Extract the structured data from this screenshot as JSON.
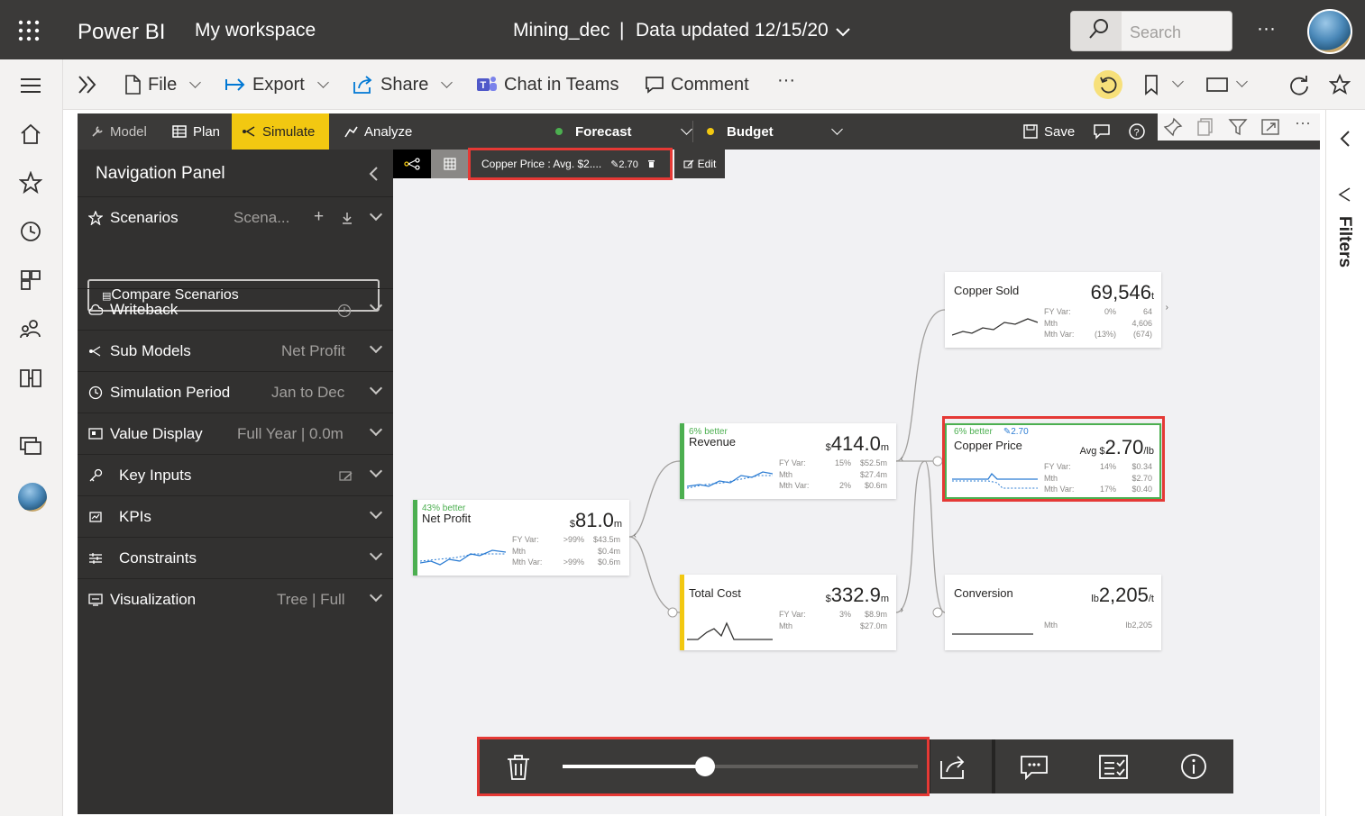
{
  "topbar": {
    "app_name": "Power BI",
    "workspace": "My workspace",
    "report_name": "Mining_dec",
    "separator": "|",
    "data_updated": "Data updated 12/15/20",
    "search_placeholder": "Search",
    "more": "···"
  },
  "toolbar": {
    "file": "File",
    "export": "Export",
    "share": "Share",
    "chat_in_teams": "Chat in Teams",
    "comment": "Comment",
    "more": "···"
  },
  "visual_header": {
    "tabs": [
      {
        "label": "Model",
        "active": false
      },
      {
        "label": "Plan",
        "active": false
      },
      {
        "label": "Simulate",
        "active": true
      },
      {
        "label": "Analyze",
        "active": false
      }
    ],
    "forecast": "Forecast",
    "budget": "Budget",
    "save": "Save",
    "colors": {
      "forecast_dot": "#4caf50",
      "budget_dot": "#f2c811",
      "accent": "#f2c811"
    }
  },
  "nav_panel": {
    "title": "Navigation Panel",
    "scenarios": {
      "label": "Scenarios",
      "value": "Scena..."
    },
    "compare_button": "Compare Scenarios",
    "rows": [
      {
        "label": "Writeback",
        "value": ""
      },
      {
        "label": "Sub Models",
        "value": "Net Profit"
      },
      {
        "label": "Simulation Period",
        "value": "Jan to Dec"
      },
      {
        "label": "Value Display",
        "value": "Full Year | 0.0m"
      },
      {
        "label": "Key Inputs",
        "value": ""
      },
      {
        "label": "KPIs",
        "value": ""
      },
      {
        "label": "Constraints",
        "value": ""
      },
      {
        "label": "Visualization",
        "value": "Tree | Full"
      }
    ]
  },
  "canvas_toolbar": {
    "selection": "Copper Price : Avg. $2....",
    "edit_value": "2.70",
    "edit": "Edit"
  },
  "cards": {
    "net_profit": {
      "better": "43% better",
      "name": "Net Profit",
      "value_prefix": "$",
      "value": "81.0",
      "unit": "m",
      "stats": [
        [
          "FY Var:",
          ">99%",
          "$43.5m"
        ],
        [
          "Mth",
          "",
          "$0.4m"
        ],
        [
          "Mth Var:",
          ">99%",
          "$0.6m"
        ]
      ]
    },
    "revenue": {
      "better": "6% better",
      "name": "Revenue",
      "value_prefix": "$",
      "value": "414.0",
      "unit": "m",
      "stats": [
        [
          "FY Var:",
          "15%",
          "$52.5m"
        ],
        [
          "Mth",
          "",
          "$27.4m"
        ],
        [
          "Mth Var:",
          "2%",
          "$0.6m"
        ]
      ]
    },
    "total_cost": {
      "better": "",
      "name": "Total Cost",
      "value_prefix": "$",
      "value": "332.9",
      "unit": "m",
      "stats": [
        [
          "FY Var:",
          "3%",
          "$8.9m"
        ],
        [
          "Mth",
          "",
          "$27.0m"
        ]
      ]
    },
    "copper_sold": {
      "better": "",
      "name": "Copper Sold",
      "value_prefix": "",
      "value": "69,546",
      "unit": "t",
      "stats": [
        [
          "FY Var:",
          "0%",
          "64"
        ],
        [
          "Mth",
          "",
          "4,606"
        ],
        [
          "Mth Var:",
          "(13%)",
          "(674)"
        ]
      ]
    },
    "copper_price": {
      "better": "6% better",
      "edit_value": "2.70",
      "name": "Copper Price",
      "value_prefix": "Avg $",
      "value": "2.70",
      "unit": "/lb",
      "stats": [
        [
          "FY Var:",
          "14%",
          "$0.34"
        ],
        [
          "Mth",
          "",
          "$2.70"
        ],
        [
          "Mth Var:",
          "17%",
          "$0.40"
        ]
      ]
    },
    "conversion": {
      "better": "",
      "name": "Conversion",
      "value_prefix": "lb",
      "value": "2,205",
      "unit": "/t",
      "stats": [
        [
          "Mth",
          "",
          "lb2,205"
        ]
      ]
    }
  },
  "slider": {
    "value_fraction": 0.4
  }
}
